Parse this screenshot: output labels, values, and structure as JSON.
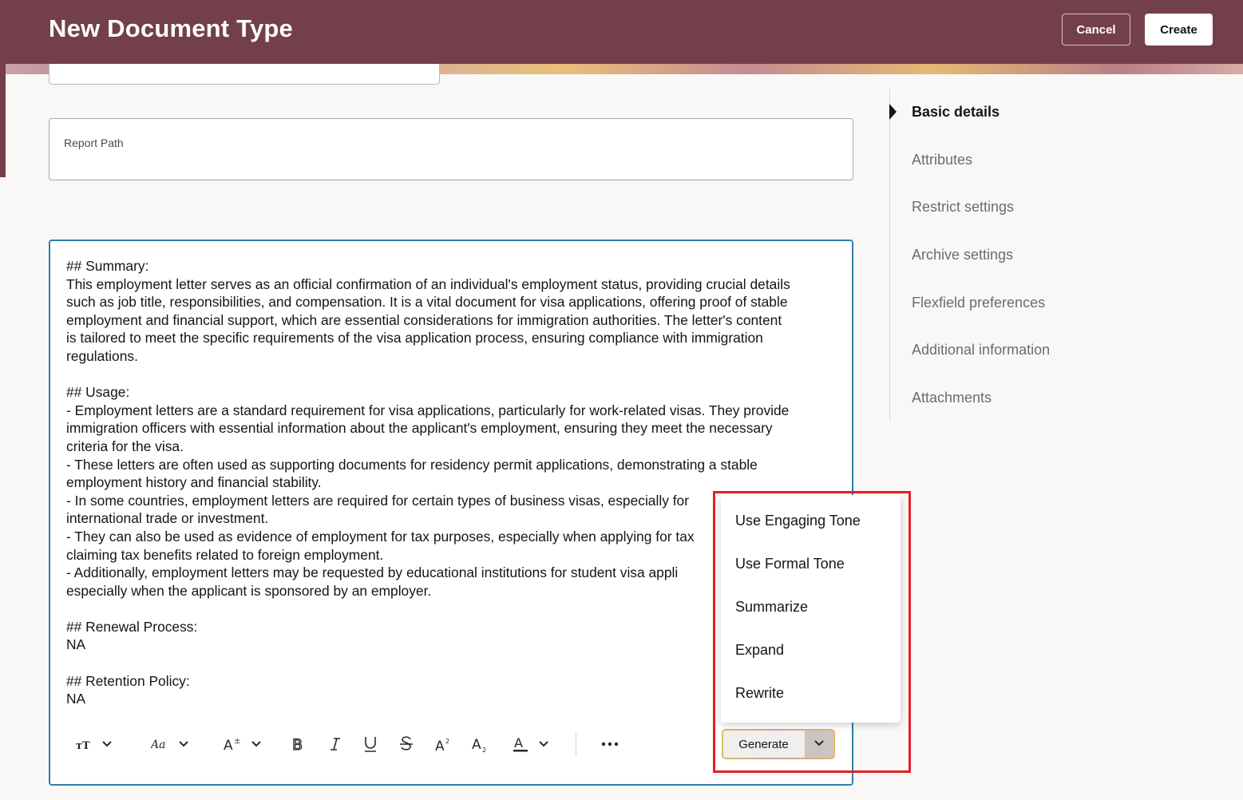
{
  "header": {
    "title": "New Document Type",
    "cancel_label": "Cancel",
    "create_label": "Create"
  },
  "form": {
    "report_path_label": "Report Path"
  },
  "editor": {
    "content": "## Summary:\nThis employment letter serves as an official confirmation of an individual's employment status, providing crucial details\nsuch as job title, responsibilities, and compensation. It is a vital document for visa applications, offering proof of stable\nemployment and financial support, which are essential considerations for immigration authorities. The letter's content\nis tailored to meet the specific requirements of the visa application process, ensuring compliance with immigration\nregulations.\n\n## Usage:\n- Employment letters are a standard requirement for visa applications, particularly for work-related visas. They provide\nimmigration officers with essential information about the applicant's employment, ensuring they meet the necessary\ncriteria for the visa.\n- These letters are often used as supporting documents for residency permit applications, demonstrating a stable\nemployment history and financial stability.\n- In some countries, employment letters are required for certain types of business visas, especially for\ninternational trade or investment.\n- They can also be used as evidence of employment for tax purposes, especially when applying for tax\nclaiming tax benefits related to foreign employment.\n- Additionally, employment letters may be requested by educational institutions for student visa appli\nespecially when the applicant is sponsored by an employer.\n\n## Renewal Process:\nNA\n\n## Retention Policy:\nNA",
    "generate_label": "Generate"
  },
  "toolbar": {
    "icons": [
      "text-size-icon",
      "font-family-icon",
      "font-size-icon",
      "bold-icon",
      "italic-icon",
      "underline-icon",
      "strikethrough-icon",
      "superscript-icon",
      "subscript-icon",
      "text-color-icon",
      "more-icon"
    ]
  },
  "menu": {
    "items": [
      {
        "label": "Use Engaging Tone"
      },
      {
        "label": "Use Formal Tone"
      },
      {
        "label": "Summarize"
      },
      {
        "label": "Expand"
      },
      {
        "label": "Rewrite"
      }
    ]
  },
  "nav": {
    "items": [
      {
        "label": "Basic details",
        "active": true
      },
      {
        "label": "Attributes"
      },
      {
        "label": "Restrict settings"
      },
      {
        "label": "Archive settings"
      },
      {
        "label": "Flexfield preferences"
      },
      {
        "label": "Additional information"
      },
      {
        "label": "Attachments"
      }
    ]
  },
  "colors": {
    "header": "#733f4b",
    "focus_border": "#2f7fa8",
    "highlight": "#e41f25"
  }
}
